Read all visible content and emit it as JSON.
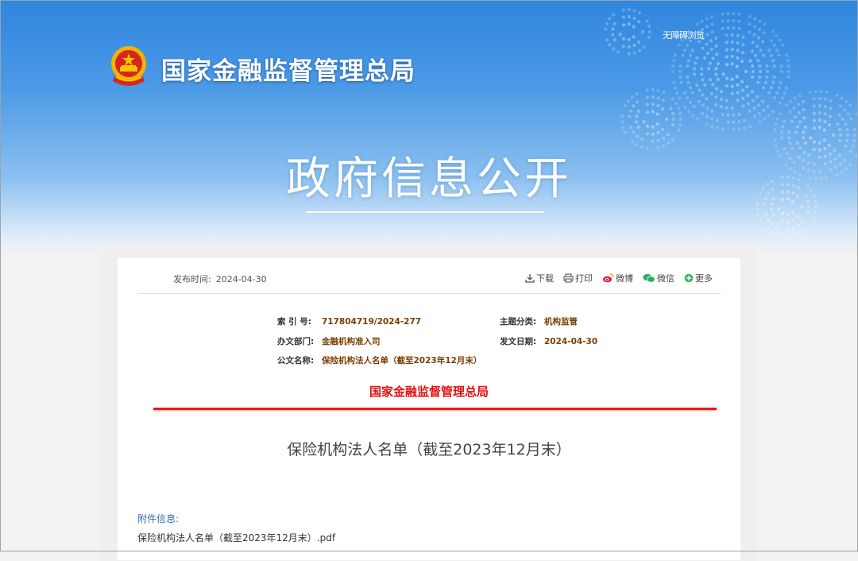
{
  "header": {
    "agency_name": "国家金融监督管理总局",
    "accessible_link": "无障碍浏览",
    "section_title": "政府信息公开"
  },
  "meta": {
    "publish_label": "发布时间:",
    "publish_date": "2024-04-30",
    "tools": {
      "download": "下载",
      "print": "打印",
      "weibo": "微博",
      "wechat": "微信",
      "more": "更多"
    }
  },
  "info": {
    "index_label": "索 引 号:",
    "index_value": "717804719/2024-277",
    "dept_label": "办文部门:",
    "dept_value": "金融机构准入司",
    "name_label": "公文名称:",
    "name_value": "保险机构法人名单（截至2023年12月末）",
    "topic_label": "主题分类:",
    "topic_value": "机构监管",
    "date_label": "发文日期:",
    "date_value": "2024-04-30"
  },
  "document": {
    "issuer": "国家金融监督管理总局",
    "title": "保险机构法人名单（截至2023年12月末）"
  },
  "attachment": {
    "label": "附件信息:",
    "file": "保险机构法人名单（截至2023年12月末）.pdf"
  },
  "colors": {
    "banner_blue": "#2f86de",
    "issuer_red": "#e01010",
    "value_brown": "#7a3d00",
    "link_blue": "#2f6db5"
  }
}
